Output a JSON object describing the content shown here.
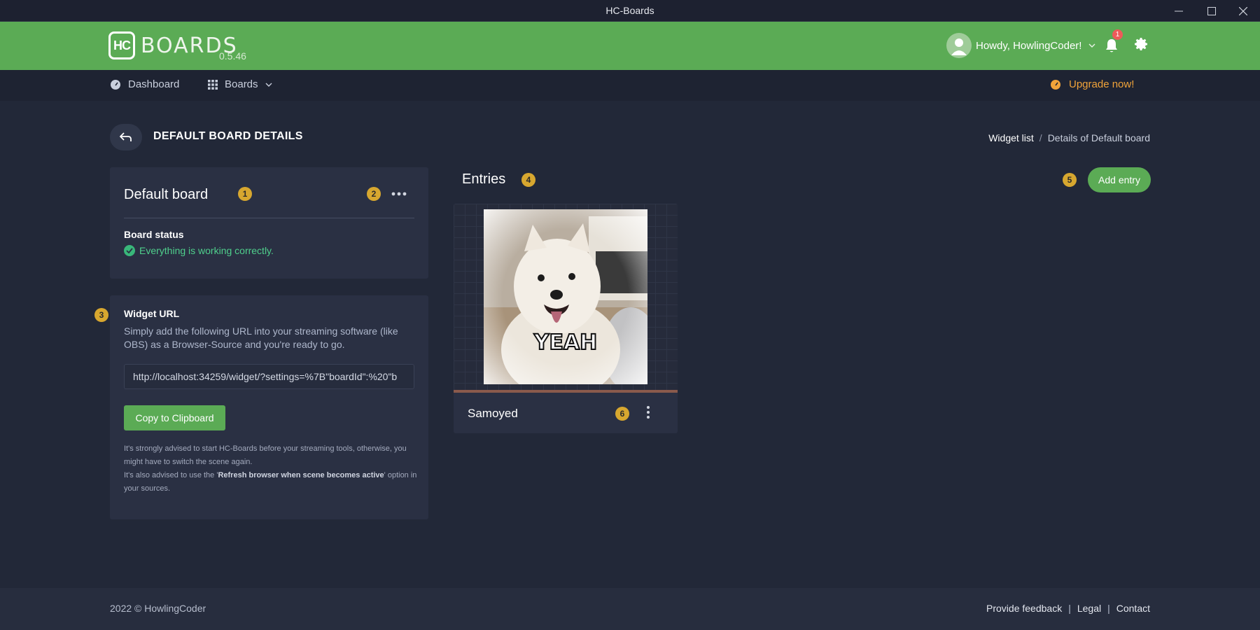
{
  "window": {
    "title": "HC-Boards"
  },
  "header": {
    "logo_mark": "HC",
    "logo_text": "BOARDS",
    "version": "0.5.46",
    "user_greeting": "Howdy, HowlingCoder!",
    "notification_count": "1"
  },
  "nav": {
    "dashboard": "Dashboard",
    "boards": "Boards",
    "upgrade": "Upgrade now!"
  },
  "page": {
    "title": "DEFAULT BOARD DETAILS",
    "breadcrumb": [
      "Widget list",
      "/",
      "Details of Default board"
    ]
  },
  "board_card": {
    "name": "Default board",
    "badge_name": "1",
    "badge_menu": "2",
    "status_label": "Board status",
    "status_text": "Everything is working correctly."
  },
  "widget_card": {
    "badge": "3",
    "title": "Widget URL",
    "description": "Simply add the following URL into your streaming software (like OBS) as a Browser-Source and you're ready to go.",
    "url": "http://localhost:34259/widget/?settings=%7B\"boardId\":%20\"b",
    "copy_label": "Copy to Clipboard",
    "note_1": "It's strongly advised to start HC-Boards before your streaming tools, otherwise, you might have to switch the scene again.",
    "note_2_before": "It's also advised to use the '",
    "note_2_bold": "Refresh browser when scene becomes active",
    "note_2_after": "' option in your sources."
  },
  "entries": {
    "title": "Entries",
    "badge_title": "4",
    "badge_add": "5",
    "add_label": "Add entry",
    "items": [
      {
        "name": "Samoyed",
        "caption": "YEAH",
        "badge": "6"
      }
    ]
  },
  "footer": {
    "copyright": "2022 © HowlingCoder",
    "links": [
      "Provide feedback",
      "|",
      "Legal",
      "|",
      "Contact"
    ]
  },
  "colors": {
    "header_green": "#5bab55",
    "badge_gold": "#d7a72f",
    "upgrade_orange": "#f0a33a",
    "status_green": "#4fcf8c",
    "notification_red": "#ee5a5a"
  }
}
